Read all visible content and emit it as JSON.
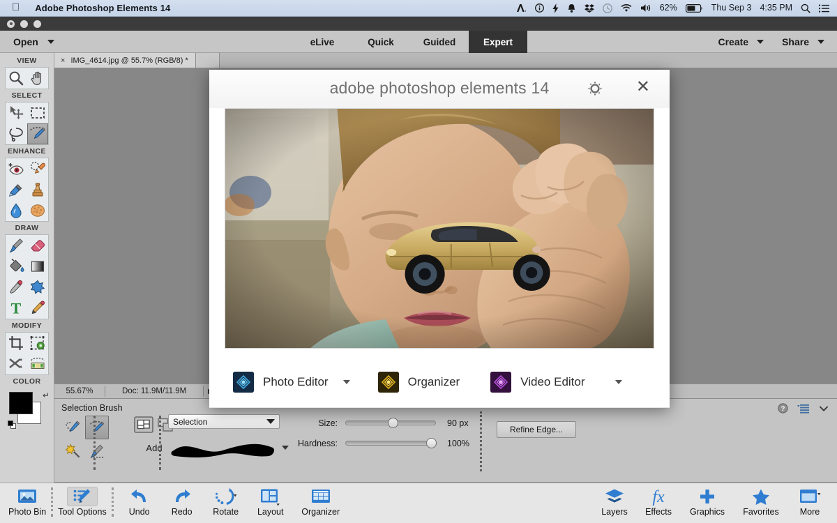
{
  "mac_menubar": {
    "apple_logo": "apple-icon",
    "app_title": "Adobe Photoshop Elements 14",
    "status_items": [
      {
        "name": "adobe-cc-icon",
        "glyph": "◤"
      },
      {
        "name": "info-icon",
        "glyph": "ⓘ"
      },
      {
        "name": "bolt-icon",
        "glyph": "⚡"
      },
      {
        "name": "bell-icon",
        "glyph": "🔔"
      },
      {
        "name": "dropbox-icon",
        "glyph": "❖"
      },
      {
        "name": "time-machine-icon",
        "glyph": "◷"
      },
      {
        "name": "wifi-icon",
        "glyph": "◔"
      },
      {
        "name": "volume-icon",
        "glyph": "🔊"
      }
    ],
    "battery_percent": "62%",
    "clock_day": "Thu Sep 3",
    "clock_time": "4:35 PM",
    "spotlight": "search-icon",
    "notification_center": "list-icon"
  },
  "topbar": {
    "open_label": "Open",
    "modes": [
      {
        "label": "eLive",
        "active": false
      },
      {
        "label": "Quick",
        "active": false
      },
      {
        "label": "Guided",
        "active": false
      },
      {
        "label": "Expert",
        "active": true
      }
    ],
    "create_label": "Create",
    "share_label": "Share"
  },
  "document_tab": {
    "close_glyph": "×",
    "label": "IMG_4614.jpg @ 55.7% (RGB/8) *"
  },
  "toolbox": {
    "sections": [
      {
        "heading": "VIEW",
        "tools": [
          {
            "name": "zoom-tool",
            "selected": false
          },
          {
            "name": "hand-tool",
            "selected": false
          }
        ]
      },
      {
        "heading": "SELECT",
        "tools": [
          {
            "name": "move-tool",
            "selected": false
          },
          {
            "name": "rectangular-marquee-tool",
            "selected": false
          },
          {
            "name": "lasso-tool",
            "selected": false
          },
          {
            "name": "selection-brush-tool",
            "selected": true
          }
        ]
      },
      {
        "heading": "ENHANCE",
        "tools": [
          {
            "name": "red-eye-removal-tool",
            "selected": false
          },
          {
            "name": "spot-healing-brush-tool",
            "selected": false
          },
          {
            "name": "smart-brush-tool",
            "selected": false
          },
          {
            "name": "clone-stamp-tool",
            "selected": false
          },
          {
            "name": "blur-tool",
            "selected": false
          },
          {
            "name": "sponge-tool",
            "selected": false
          }
        ]
      },
      {
        "heading": "DRAW",
        "tools": [
          {
            "name": "brush-tool",
            "selected": false
          },
          {
            "name": "eraser-tool",
            "selected": false
          },
          {
            "name": "paint-bucket-tool",
            "selected": false
          },
          {
            "name": "gradient-tool",
            "selected": false
          },
          {
            "name": "eyedropper-tool",
            "selected": false
          },
          {
            "name": "custom-shape-tool",
            "selected": false
          },
          {
            "name": "type-tool",
            "selected": false
          },
          {
            "name": "pencil-tool",
            "selected": false
          }
        ]
      },
      {
        "heading": "MODIFY",
        "tools": [
          {
            "name": "crop-tool",
            "selected": false
          },
          {
            "name": "recompose-tool",
            "selected": false
          },
          {
            "name": "content-aware-move-tool",
            "selected": false
          },
          {
            "name": "straighten-tool",
            "selected": false
          }
        ]
      }
    ],
    "color_heading": "COLOR",
    "foreground_color": "#000000",
    "background_color": "#ffffff"
  },
  "statusbar": {
    "zoom": "55.67%",
    "doc": "Doc: 11.9M/11.9M",
    "more_glyph": "▶"
  },
  "tool_options": {
    "title": "Selection Brush",
    "tool_icons": [
      {
        "name": "quick-selection-tool-option",
        "selected": false
      },
      {
        "name": "selection-brush-tool-option",
        "selected": true
      },
      {
        "name": "magic-wand-tool-option",
        "selected": false
      },
      {
        "name": "auto-selection-tool-option",
        "selected": false
      }
    ],
    "mode_label": "Add",
    "mode_icons": [
      {
        "name": "add-to-selection-icon",
        "selected": true
      },
      {
        "name": "subtract-from-selection-icon",
        "selected": false
      }
    ],
    "selection_dropdown_value": "Selection",
    "brush_preset_name": "brush-preview-stroke",
    "size_label": "Size:",
    "size_value": "90 px",
    "size_percent": 52,
    "hardness_label": "Hardness:",
    "hardness_value": "100%",
    "hardness_percent": 100,
    "refine_edge_label": "Refine Edge...",
    "right_icons": [
      {
        "name": "help-icon",
        "glyph": "?"
      },
      {
        "name": "panel-menu-icon",
        "glyph": "≡"
      },
      {
        "name": "chevron-down-icon",
        "glyph": "⌄"
      }
    ]
  },
  "taskbar": {
    "left_items": [
      {
        "name": "photo-bin-button",
        "label": "Photo Bin",
        "icon": "photo-bin-icon",
        "boxed": false,
        "has_caret": false
      },
      {
        "name": "tool-options-button",
        "label": "Tool Options",
        "icon": "tool-options-icon",
        "boxed": true,
        "has_caret": false
      },
      {
        "name": "undo-button",
        "label": "Undo",
        "icon": "undo-icon",
        "boxed": false,
        "has_caret": false
      },
      {
        "name": "redo-button",
        "label": "Redo",
        "icon": "redo-icon",
        "boxed": false,
        "has_caret": false
      },
      {
        "name": "rotate-button",
        "label": "Rotate",
        "icon": "rotate-icon",
        "boxed": false,
        "has_caret": true
      },
      {
        "name": "layout-button",
        "label": "Layout",
        "icon": "layout-icon",
        "boxed": false,
        "has_caret": true
      },
      {
        "name": "organizer-button",
        "label": "Organizer",
        "icon": "organizer-icon",
        "boxed": false,
        "has_caret": false
      }
    ],
    "right_items": [
      {
        "name": "layers-button",
        "label": "Layers",
        "icon": "layers-icon",
        "has_caret": false
      },
      {
        "name": "effects-button",
        "label": "Effects",
        "icon": "fx-icon",
        "has_caret": false
      },
      {
        "name": "graphics-button",
        "label": "Graphics",
        "icon": "plus-icon",
        "has_caret": false
      },
      {
        "name": "favorites-button",
        "label": "Favorites",
        "icon": "star-icon",
        "has_caret": false
      },
      {
        "name": "more-button",
        "label": "More",
        "icon": "more-panel-icon",
        "has_caret": true
      }
    ]
  },
  "welcome_modal": {
    "title": "adobe photoshop elements 14",
    "gear_icon": "gear-icon",
    "close_icon": "close-icon",
    "hero_alt": "boy holding gold toy car in front of his eye",
    "launch_buttons": [
      {
        "name": "photo-editor-launch",
        "label": "Photo Editor",
        "color": "#1b3a5c",
        "accent": "#31a8e0",
        "has_caret": true
      },
      {
        "name": "organizer-launch",
        "label": "Organizer",
        "color": "#3d3108",
        "accent": "#f7c20a",
        "has_caret": false
      },
      {
        "name": "video-editor-launch",
        "label": "Video Editor",
        "color": "#3a1444",
        "accent": "#b45de0",
        "has_caret": true
      }
    ]
  },
  "colors": {
    "canvas_gray": "#878787",
    "chrome_gray": "#c6c6c6",
    "active_tab_dark": "#333333",
    "taskbar_blue": "#2f7dd1"
  }
}
